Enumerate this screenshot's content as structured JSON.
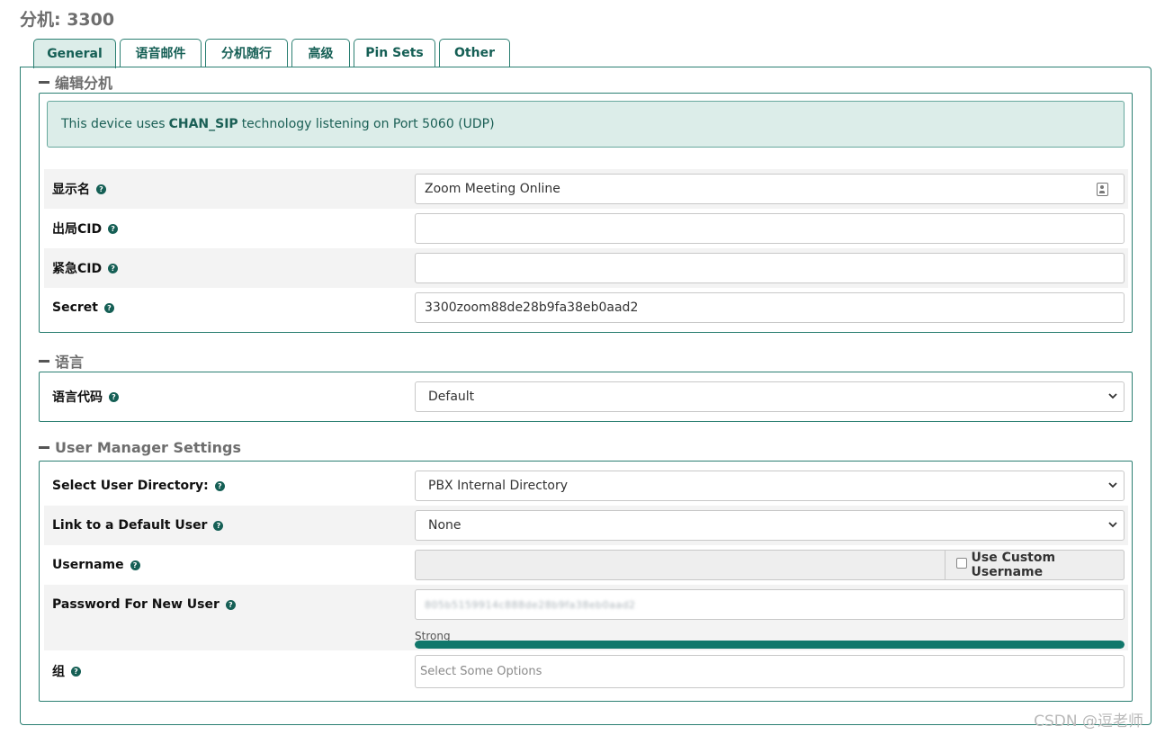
{
  "page_title": "分机: 3300",
  "tabs": [
    {
      "label": "General",
      "active": true
    },
    {
      "label": "语音邮件",
      "active": false
    },
    {
      "label": "分机随行",
      "active": false
    },
    {
      "label": "高级",
      "active": false
    },
    {
      "label": "Pin Sets",
      "active": false
    },
    {
      "label": "Other",
      "active": false
    }
  ],
  "sections": {
    "edit": {
      "title": "编辑分机",
      "alert": {
        "prefix": "This device uses",
        "tech": "CHAN_SIP",
        "suffix": "technology listening on Port 5060 (UDP)"
      },
      "fields": {
        "display_name": {
          "label": "显示名",
          "value": "Zoom Meeting Online"
        },
        "outbound_cid": {
          "label": "出局CID",
          "value": ""
        },
        "emergency_cid": {
          "label": "紧急CID",
          "value": ""
        },
        "secret": {
          "label": "Secret",
          "value": "3300zoom88de28b9fa38eb0aad2"
        }
      }
    },
    "language": {
      "title": "语言",
      "fields": {
        "language_code": {
          "label": "语言代码",
          "value": "Default"
        }
      }
    },
    "user_manager": {
      "title": "User Manager Settings",
      "fields": {
        "user_directory": {
          "label": "Select User Directory:",
          "value": "PBX Internal Directory"
        },
        "default_user": {
          "label": "Link to a Default User",
          "value": "None"
        },
        "username": {
          "label": "Username",
          "value": "",
          "addon_label": "Use Custom Username",
          "addon_checked": false
        },
        "password": {
          "label": "Password For New User",
          "value": "805b5159914c888de28b9fa38eb0aad2",
          "strength_label": "Strong",
          "strength": 1.0
        },
        "groups": {
          "label": "组",
          "placeholder": "Select Some Options"
        }
      }
    }
  },
  "help_glyph": "?",
  "watermark": "CSDN @逗老师",
  "colors": {
    "accent": "#155f55",
    "border": "#2b7f72",
    "alert_bg": "#dcede9",
    "strength": "#10776b"
  }
}
